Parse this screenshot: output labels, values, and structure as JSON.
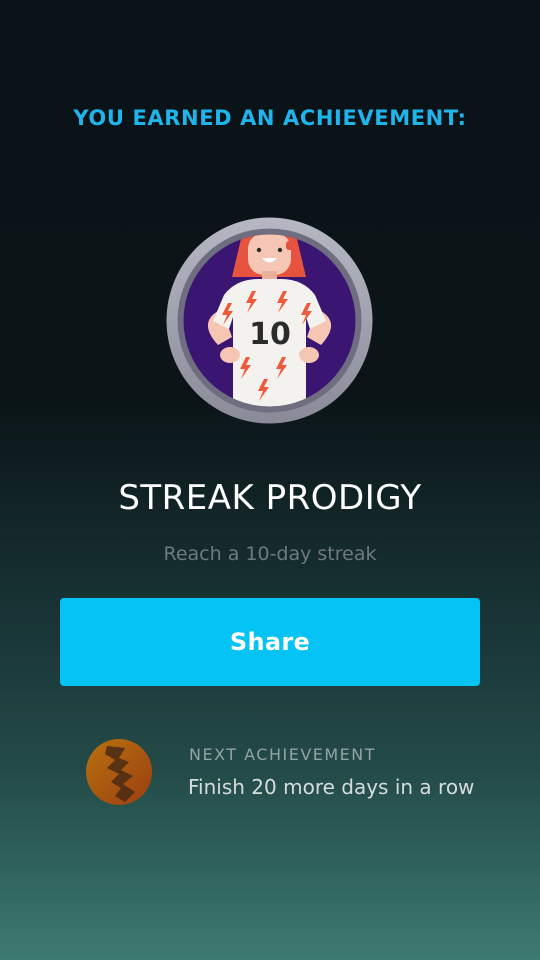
{
  "header": {
    "headline": "YOU EARNED AN ACHIEVEMENT:"
  },
  "achievement": {
    "badge_icon": "streak-prodigy-badge-icon",
    "badge_number": "10",
    "title": "STREAK PRODIGY",
    "description": "Reach a 10-day streak"
  },
  "actions": {
    "share_label": "Share"
  },
  "next_achievement": {
    "badge_icon": "locked-bronze-badge-icon",
    "label": "NEXT ACHIEVEMENT",
    "description": "Finish 20 more days in a row"
  },
  "colors": {
    "accent": "#1fb4ea",
    "button": "#06c3f6",
    "badge_ring": "#a9a9b6",
    "badge_inner": "#3a1672"
  }
}
